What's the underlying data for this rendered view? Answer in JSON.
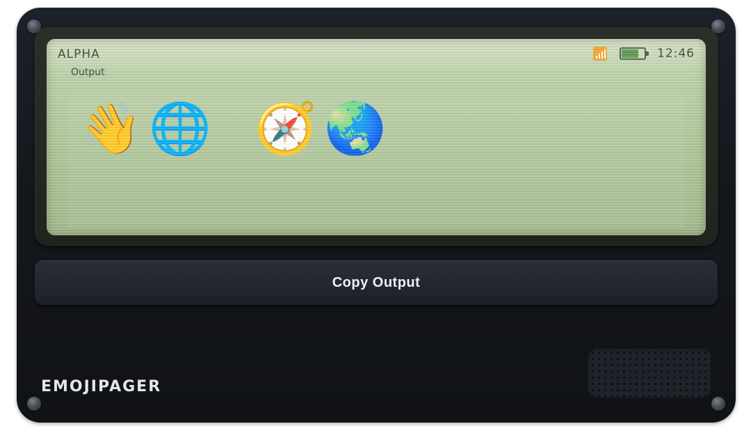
{
  "screen": {
    "mode_label": "ALPHA",
    "output_label": "Output",
    "clock": "12:46",
    "battery_level_percent": 75,
    "output_emojis": [
      "👋",
      "🌐",
      "🧭",
      "🌏"
    ]
  },
  "actions": {
    "copy_label": "Copy Output"
  },
  "device": {
    "brand": "EMOJIPAGER"
  },
  "icons": {
    "signal": "signal-bars-icon",
    "battery": "battery-icon"
  },
  "colors": {
    "lcd_background": "#b5ca9f",
    "lcd_text": "#3b4a35",
    "device_body": "#16191e",
    "signal_accent": "#f2a531",
    "battery_fill": "#5c9a55"
  }
}
